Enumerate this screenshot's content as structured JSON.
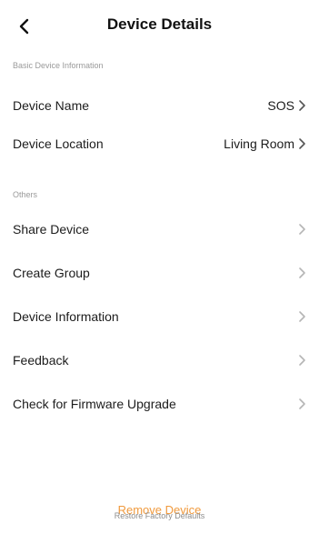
{
  "header": {
    "title": "Device Details",
    "back_icon": "chevron-left-icon"
  },
  "sections": {
    "basic": "Basic Device Information",
    "others": "Others"
  },
  "rows": {
    "device_name": {
      "label": "Device Name",
      "value": "SOS"
    },
    "device_location": {
      "label": "Device Location",
      "value": "Living Room"
    },
    "share_device": {
      "label": "Share Device"
    },
    "create_group": {
      "label": "Create Group"
    },
    "device_information": {
      "label": "Device Information"
    },
    "feedback": {
      "label": "Feedback"
    },
    "firmware_upgrade": {
      "label": "Check for Firmware Upgrade"
    }
  },
  "actions": {
    "remove_device": "Remove Device",
    "restore_factory": "Restore Factory Defaults"
  },
  "colors": {
    "accent": "#f09a3e",
    "chevron_dark": "#555555",
    "chevron_light": "#b5b5b5"
  }
}
